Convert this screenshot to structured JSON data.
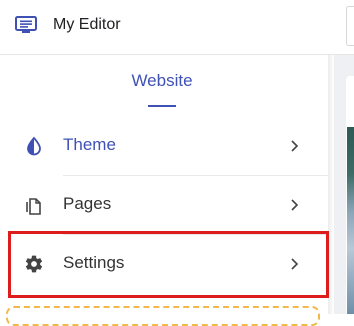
{
  "app": {
    "title": "My Editor"
  },
  "tabs": {
    "active_label": "Website"
  },
  "menu": [
    {
      "label": "Theme",
      "icon": "theme-contrast-icon",
      "color": "#3f51b5"
    },
    {
      "label": "Pages",
      "icon": "pages-icon",
      "color": "#333333"
    },
    {
      "label": "Settings",
      "icon": "gear-icon",
      "color": "#333333"
    }
  ],
  "colors": {
    "accent": "#3f51b5",
    "highlight_border": "#dd1c1c",
    "dashed_border": "#f2b84a"
  }
}
